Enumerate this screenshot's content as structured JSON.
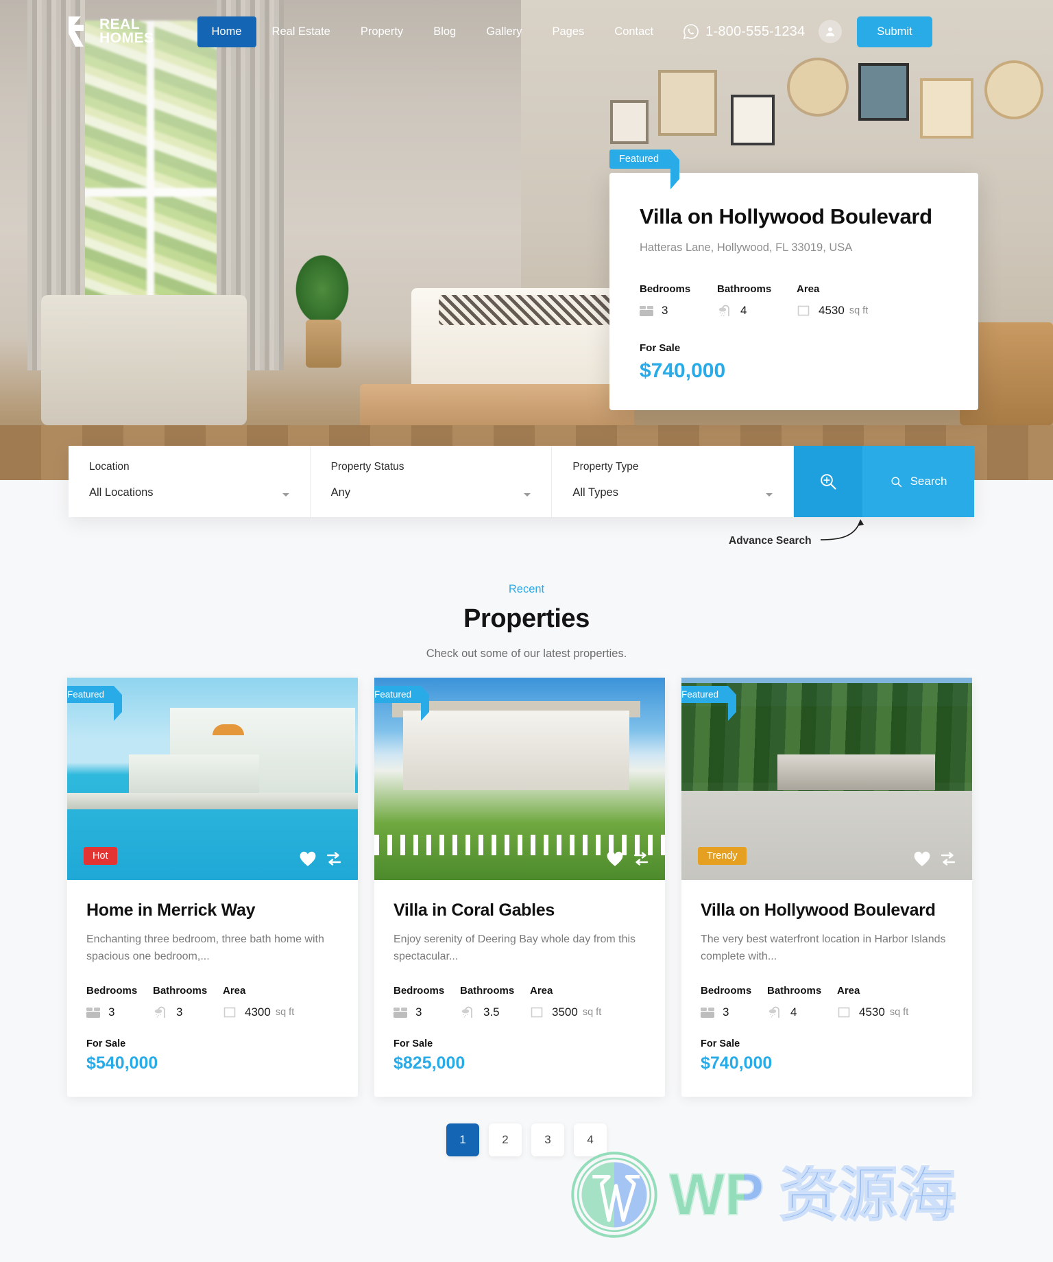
{
  "header": {
    "logo_line1": "REAL",
    "logo_line2": "HOMES",
    "nav": [
      {
        "label": "Home",
        "active": true
      },
      {
        "label": "Real Estate",
        "active": false
      },
      {
        "label": "Property",
        "active": false
      },
      {
        "label": "Blog",
        "active": false
      },
      {
        "label": "Gallery",
        "active": false
      },
      {
        "label": "Pages",
        "active": false
      },
      {
        "label": "Contact",
        "active": false
      }
    ],
    "phone": "1-800-555-1234",
    "submit_label": "Submit",
    "accent": "#29ABE8",
    "active_nav_bg": "#1565b5"
  },
  "hero_card": {
    "ribbon": "Featured",
    "title": "Villa on Hollywood Boulevard",
    "address": "Hatteras Lane, Hollywood, FL 33019, USA",
    "spec_labels": {
      "bedrooms": "Bedrooms",
      "bathrooms": "Bathrooms",
      "area": "Area"
    },
    "bedrooms": "3",
    "bathrooms": "4",
    "area": "4530",
    "area_unit": "sq ft",
    "status": "For Sale",
    "price": "$740,000"
  },
  "search": {
    "fields": [
      {
        "label": "Location",
        "value": "All Locations"
      },
      {
        "label": "Property Status",
        "value": "Any"
      },
      {
        "label": "Property Type",
        "value": "All Types"
      }
    ],
    "search_label": "Search",
    "advance_note": "Advance Search"
  },
  "section": {
    "eyebrow": "Recent",
    "title": "Properties",
    "subtitle": "Check out some of our latest properties."
  },
  "properties": [
    {
      "ribbon": "Featured",
      "tag": "Hot",
      "tag_color": "#E33434",
      "title": "Home in Merrick Way",
      "description": "Enchanting three bedroom, three bath home with spacious one bedroom,...",
      "labels": {
        "bedrooms": "Bedrooms",
        "bathrooms": "Bathrooms",
        "area": "Area"
      },
      "bedrooms": "3",
      "bathrooms": "3",
      "area": "4300",
      "area_unit": "sq ft",
      "status": "For Sale",
      "price": "$540,000"
    },
    {
      "ribbon": "Featured",
      "tag": "",
      "tag_color": "",
      "title": "Villa in Coral Gables",
      "description": "Enjoy serenity of Deering Bay whole day from this spectacular...",
      "labels": {
        "bedrooms": "Bedrooms",
        "bathrooms": "Bathrooms",
        "area": "Area"
      },
      "bedrooms": "3",
      "bathrooms": "3.5",
      "area": "3500",
      "area_unit": "sq ft",
      "status": "For Sale",
      "price": "$825,000"
    },
    {
      "ribbon": "Featured",
      "tag": "Trendy",
      "tag_color": "#E5A021",
      "title": "Villa on Hollywood Boulevard",
      "description": "The very best waterfront location in Harbor Islands complete with...",
      "labels": {
        "bedrooms": "Bedrooms",
        "bathrooms": "Bathrooms",
        "area": "Area"
      },
      "bedrooms": "3",
      "bathrooms": "4",
      "area": "4530",
      "area_unit": "sq ft",
      "status": "For Sale",
      "price": "$740,000"
    }
  ],
  "pagination": {
    "pages": [
      "1",
      "2",
      "3",
      "4"
    ],
    "current": "1"
  },
  "watermark": {
    "text": "WP 资源海"
  }
}
